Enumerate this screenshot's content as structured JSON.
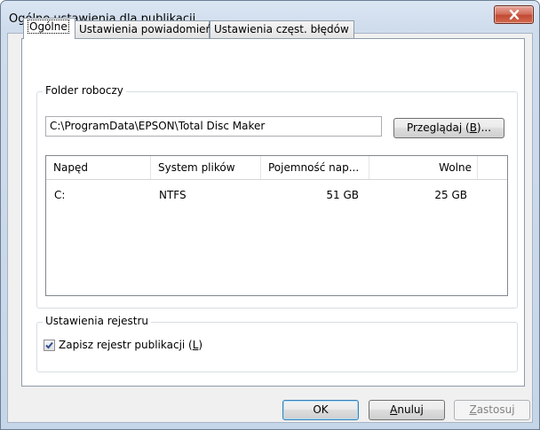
{
  "window": {
    "title": "Ogólne ustawienia dla publikacji"
  },
  "tabs": [
    {
      "label": "Ogólne"
    },
    {
      "label": "Ustawienia powiadomień"
    },
    {
      "label": "Ustawienia częst. błędów"
    }
  ],
  "work_folder": {
    "legend": "Folder roboczy",
    "path": "C:\\ProgramData\\EPSON\\Total Disc Maker",
    "browse_label_pre": "Przeglądaj (",
    "browse_mnemonic": "B",
    "browse_label_post": ")..."
  },
  "drives": {
    "columns": [
      "Napęd",
      "System plików",
      "Pojemność nap...",
      "Wolne"
    ],
    "rows": [
      {
        "drive": "C:",
        "fs": "NTFS",
        "capacity": "51 GB",
        "free": "25 GB"
      }
    ]
  },
  "log_settings": {
    "legend": "Ustawienia rejestru",
    "checkbox_label_pre": "Zapisz rejestr publikacji (",
    "checkbox_mnemonic": "L",
    "checkbox_label_post": ")",
    "checked": true
  },
  "footer": {
    "ok": "OK",
    "cancel_pre": "",
    "cancel_mnemonic": "A",
    "cancel_post": "nuluj",
    "apply_pre": "",
    "apply_mnemonic": "Z",
    "apply_post": "astosuj"
  },
  "icons": {
    "close": "close-icon",
    "check": "checkmark-icon"
  }
}
